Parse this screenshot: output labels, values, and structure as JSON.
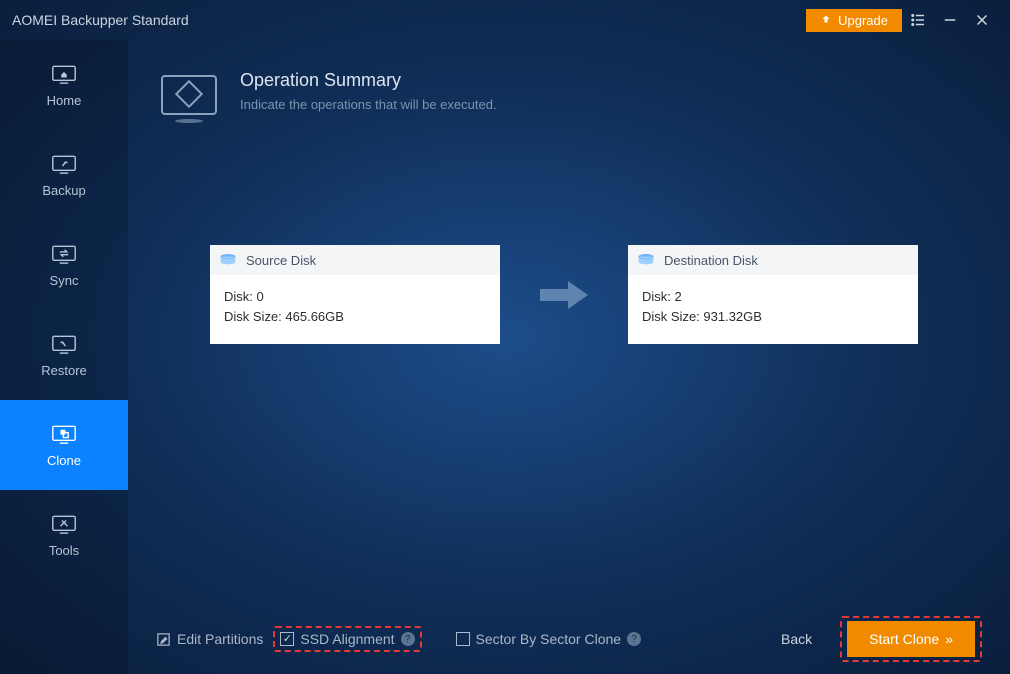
{
  "titlebar": {
    "title": "AOMEI Backupper Standard",
    "upgrade": "Upgrade"
  },
  "sidebar": {
    "items": [
      {
        "label": "Home"
      },
      {
        "label": "Backup"
      },
      {
        "label": "Sync"
      },
      {
        "label": "Restore"
      },
      {
        "label": "Clone"
      },
      {
        "label": "Tools"
      }
    ]
  },
  "header": {
    "title": "Operation Summary",
    "subtitle": "Indicate the operations that will be executed."
  },
  "source": {
    "title": "Source Disk",
    "line1": "Disk: 0",
    "line2": "Disk Size: 465.66GB"
  },
  "destination": {
    "title": "Destination Disk",
    "line1": "Disk: 2",
    "line2": "Disk Size: 931.32GB"
  },
  "footer": {
    "edit_partitions": "Edit Partitions",
    "ssd_alignment": "SSD Alignment",
    "sector_clone": "Sector By Sector Clone",
    "back": "Back",
    "start": "Start Clone"
  }
}
